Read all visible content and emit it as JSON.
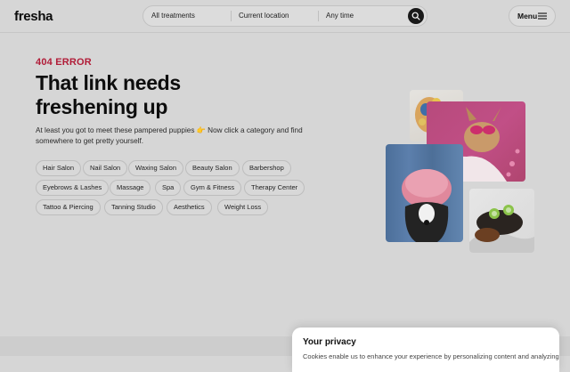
{
  "header": {
    "logo": "fresha",
    "search": {
      "treatments": "All treatments",
      "location": "Current location",
      "time": "Any time"
    },
    "menu_label": "Menu"
  },
  "main": {
    "error_code": "404 ERROR",
    "title": "That link needs freshening up",
    "subtitle": "At least you got to meet these pampered puppies 👉 Now click a category and find somewhere to get pretty yourself.",
    "categories": [
      "Hair Salon",
      "Nail Salon",
      "Waxing Salon",
      "Beauty Salon",
      "Barbershop",
      "Eyebrows & Lashes",
      "Massage",
      "Spa",
      "Gym & Fitness",
      "Therapy Center",
      "Tattoo & Piercing",
      "Tanning Studio",
      "Aesthetics",
      "Weight Loss"
    ]
  },
  "privacy": {
    "title": "Your privacy",
    "text": "Cookies enable us to enhance your experience by personalizing content and analyzing"
  }
}
